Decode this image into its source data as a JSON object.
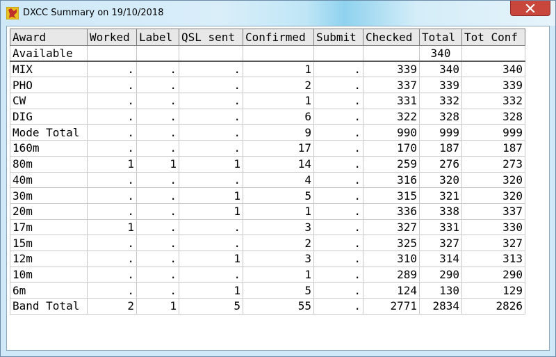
{
  "window": {
    "title": "DXCC Summary on 19/10/2018",
    "close_glyph": "✕"
  },
  "table": {
    "columns": [
      "Award",
      "Worked",
      "Label",
      "QSL sent",
      "Confirmed",
      "Submit",
      "Checked",
      "Total",
      "Tot Conf"
    ],
    "available": {
      "label": "Available",
      "total": "340"
    },
    "rows": [
      [
        "MIX",
        ".",
        ".",
        ".",
        "1",
        ".",
        "339",
        "340",
        "340"
      ],
      [
        "PHO",
        ".",
        ".",
        ".",
        "2",
        ".",
        "337",
        "339",
        "339"
      ],
      [
        "CW",
        ".",
        ".",
        ".",
        "1",
        ".",
        "331",
        "332",
        "332"
      ],
      [
        "DIG",
        ".",
        ".",
        ".",
        "6",
        ".",
        "322",
        "328",
        "328"
      ],
      [
        "Mode Total",
        ".",
        ".",
        ".",
        "9",
        ".",
        "990",
        "999",
        "999"
      ],
      [
        "160m",
        ".",
        ".",
        ".",
        "17",
        ".",
        "170",
        "187",
        "187"
      ],
      [
        "80m",
        "1",
        "1",
        "1",
        "14",
        ".",
        "259",
        "276",
        "273"
      ],
      [
        "40m",
        ".",
        ".",
        ".",
        "4",
        ".",
        "316",
        "320",
        "320"
      ],
      [
        "30m",
        ".",
        ".",
        "1",
        "5",
        ".",
        "315",
        "321",
        "320"
      ],
      [
        "20m",
        ".",
        ".",
        "1",
        "1",
        ".",
        "336",
        "338",
        "337"
      ],
      [
        "17m",
        "1",
        ".",
        ".",
        "3",
        ".",
        "327",
        "331",
        "330"
      ],
      [
        "15m",
        ".",
        ".",
        ".",
        "2",
        ".",
        "325",
        "327",
        "327"
      ],
      [
        "12m",
        ".",
        ".",
        "1",
        "3",
        ".",
        "310",
        "314",
        "313"
      ],
      [
        "10m",
        ".",
        ".",
        ".",
        "1",
        ".",
        "289",
        "290",
        "290"
      ],
      [
        "6m",
        ".",
        ".",
        "1",
        "5",
        ".",
        "124",
        "130",
        "129"
      ],
      [
        "Band Total",
        "2",
        "1",
        "5",
        "55",
        ".",
        "2771",
        "2834",
        "2826"
      ]
    ]
  },
  "colors": {
    "close_button": "#c8463c",
    "header_bg": "#e8e8e8",
    "grid_line": "#c8c8c8"
  }
}
